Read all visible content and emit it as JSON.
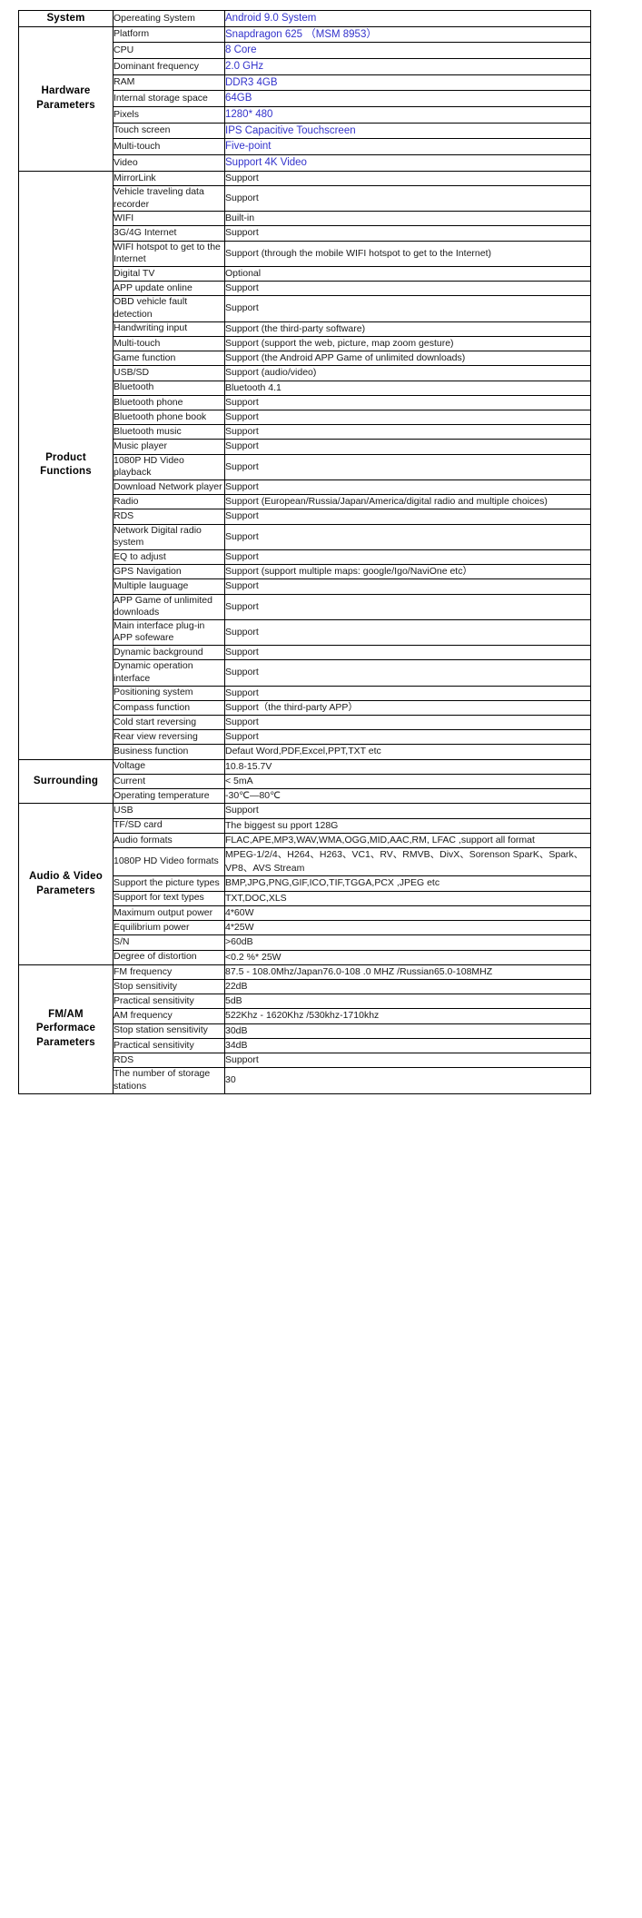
{
  "document": {
    "kind": "product-specification-table",
    "accent_blue": "#3333CC",
    "text_color": "#1A1A1A",
    "border_color": "#000000",
    "columns": [
      "Section",
      "Parameter",
      "Value"
    ]
  },
  "sections": [
    {
      "name": "System",
      "label": "System",
      "value_style": "blue",
      "rows": [
        {
          "param": "Opereating System",
          "value": "Android 9.0 System",
          "style": "blue"
        }
      ]
    },
    {
      "name": "Hardware Parameters",
      "label": "Hardware\nParameters",
      "label_lines": [
        "Hardware",
        "Parameters"
      ],
      "value_style": "blue",
      "rows": [
        {
          "param": "Platform",
          "value": "Snapdragon 625 （MSM 8953）",
          "style": "blue"
        },
        {
          "param": "CPU",
          "value": "8 Core",
          "style": "blue"
        },
        {
          "param": "Dominant frequency",
          "value": "2.0 GHz",
          "style": "blue"
        },
        {
          "param": "RAM",
          "value": "DDR3  4GB",
          "style": "blue"
        },
        {
          "param": "Internal storage space",
          "value": "64GB",
          "style": "blue"
        },
        {
          "param": "Pixels",
          "value": "1280* 480",
          "style": "blue"
        },
        {
          "param": "Touch screen",
          "value": "IPS Capacitive Touchscreen",
          "style": "blue"
        },
        {
          "param": "Multi-touch",
          "value": "Five-point",
          "style": "blue"
        },
        {
          "param": "Video",
          "value": "Support 4K Video",
          "style": "blue"
        }
      ]
    },
    {
      "name": "Product Functions",
      "label": "Product\nFunctions",
      "label_lines": [
        "Product",
        "Functions"
      ],
      "value_style": "plain",
      "rows": [
        {
          "param": "MirrorLink",
          "value": "Support"
        },
        {
          "param": "Vehicle traveling data recorder",
          "value": "Support"
        },
        {
          "param": "WIFI",
          "value": "Built-in"
        },
        {
          "param": "3G/4G  Internet",
          "value": "Support"
        },
        {
          "param": "WIFI hotspot to get to the Internet",
          "value": "Support (through the mobile WIFI hotspot to get to the Internet)"
        },
        {
          "param": "Digital TV",
          "value": "Optional"
        },
        {
          "param": "APP update online",
          "value": "Support"
        },
        {
          "param": "OBD vehicle fault detection",
          "value": "Support"
        },
        {
          "param": "Handwriting input",
          "value": "Support (the third-party software)"
        },
        {
          "param": "Multi-touch",
          "value": "Support (support the web, picture, map zoom gesture)"
        },
        {
          "param": "Game function",
          "value": "Support (the Android APP Game of unlimited downloads)"
        },
        {
          "param": "USB/SD",
          "value": "Support (audio/video)"
        },
        {
          "param": "Bluetooth",
          "value": "Bluetooth 4.1"
        },
        {
          "param": "Bluetooth phone",
          "value": "Support"
        },
        {
          "param": "Bluetooth phone book",
          "value": "Support"
        },
        {
          "param": "Bluetooth music",
          "value": "Support"
        },
        {
          "param": "Music player",
          "value": "Support"
        },
        {
          "param": "1080P HD Video playback",
          "value": "Support"
        },
        {
          "param": "Download Network player",
          "value": "Support"
        },
        {
          "param": "Radio",
          "value": "Support (European/Russia/Japan/America/digital radio and multiple choices)"
        },
        {
          "param": "RDS",
          "value": "Support"
        },
        {
          "param": "Network Digital radio system",
          "value": "Support"
        },
        {
          "param": "EQ to adjust",
          "value": "Support"
        },
        {
          "param": "GPS Navigation",
          "value": "Support (support multiple maps: google/Igo/NaviOne etc）"
        },
        {
          "param": "Multiple lauguage",
          "value": "Support"
        },
        {
          "param": "APP Game of unlimited downloads",
          "value": "Support"
        },
        {
          "param": "Main interface plug-in APP sofeware",
          "value": "Support"
        },
        {
          "param": "Dynamic background",
          "value": "Support"
        },
        {
          "param": "Dynamic operation interface",
          "value": "Support"
        },
        {
          "param": "Positioning system",
          "value": "Support"
        },
        {
          "param": "Compass function",
          "value": "Support（the third-party APP）"
        },
        {
          "param": "Cold start reversing",
          "value": "Support"
        },
        {
          "param": "Rear view reversing",
          "value": "Support"
        },
        {
          "param": "Business function",
          "value": "Defaut Word,PDF,Excel,PPT,TXT etc"
        }
      ]
    },
    {
      "name": "Surrounding",
      "label": "Surrounding",
      "label_lines": [
        "Surrounding"
      ],
      "value_style": "plain",
      "rows": [
        {
          "param": "Voltage",
          "value": "10.8-15.7V"
        },
        {
          "param": "Current",
          "value": "< 5mA"
        },
        {
          "param": "Operating temperature",
          "value": " -30℃—80℃"
        }
      ]
    },
    {
      "name": "Audio & Video Parameters",
      "label": "Audio & Video\nParameters",
      "label_lines": [
        "Audio & Video",
        "Parameters"
      ],
      "value_style": "plain",
      "rows": [
        {
          "param": "USB",
          "value": "Support"
        },
        {
          "param": "TF/SD card",
          "value": "The biggest su pport 128G"
        },
        {
          "param": "Audio formats",
          "value": "FLAC,APE,MP3,WAV,WMA,OGG,MID,AAC,RM, LFAC ,support all format"
        },
        {
          "param": "1080P HD Video formats",
          "value": "MPEG-1/2/4、H264、H263、VC1、RV、RMVB、DivX、Sorenson SparK、Spark、VP8、AVS Stream"
        },
        {
          "param": "Support the picture types",
          "value": "BMP,JPG,PNG,GIF,ICO,TIF,TGGA,PCX ,JPEG etc"
        },
        {
          "param": "Support for text types",
          "value": "TXT,DOC,XLS"
        },
        {
          "param": "Maximum output power",
          "value": "4*60W"
        },
        {
          "param": "Equilibrium power",
          "value": "4*25W"
        },
        {
          "param": "S/N",
          "value": ">60dB"
        },
        {
          "param": "Degree of distortion",
          "value": "<0.2 %* 25W"
        }
      ]
    },
    {
      "name": "FM/AM Performace Parameters",
      "label": "FM/AM\nPerformace\nParameters",
      "label_lines": [
        "FM/AM",
        "Performace",
        "Parameters"
      ],
      "value_style": "plain",
      "rows": [
        {
          "param": "FM frequency",
          "value": "87.5 - 108.0Mhz/Japan76.0-108 .0 MHZ /Russian65.0-108MHZ"
        },
        {
          "param": "Stop sensitivity",
          "value": "22dB"
        },
        {
          "param": "Practical sensitivity",
          "value": "5dB"
        },
        {
          "param": "AM frequency",
          "value": "522Khz - 1620Khz /530khz-1710khz"
        },
        {
          "param": "Stop station sensitivity",
          "value": "30dB"
        },
        {
          "param": "Practical sensitivity",
          "value": "34dB"
        },
        {
          "param": "RDS",
          "value": "Support"
        },
        {
          "param": "The number of storage stations",
          "value": "30"
        }
      ]
    }
  ]
}
